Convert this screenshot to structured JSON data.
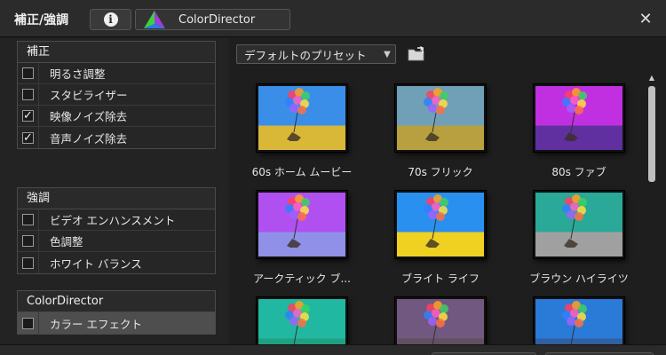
{
  "window": {
    "title": "補正/強調",
    "colordirector_button": "ColorDirector",
    "close_label": "✕",
    "info_glyph": "i"
  },
  "groups": [
    {
      "header": "補正",
      "items": [
        {
          "label": "明るさ調整",
          "checked": false
        },
        {
          "label": "スタビライザー",
          "checked": false
        },
        {
          "label": "映像ノイズ除去",
          "checked": true
        },
        {
          "label": "音声ノイズ除去",
          "checked": true
        }
      ]
    },
    {
      "header": "強調",
      "items": [
        {
          "label": "ビデオ エンハンスメント",
          "checked": false
        },
        {
          "label": "色調整",
          "checked": false
        },
        {
          "label": "ホワイト バランス",
          "checked": false
        }
      ]
    },
    {
      "header": "ColorDirector",
      "items": [
        {
          "label": "カラー エフェクト",
          "checked": false,
          "selected": true
        }
      ]
    }
  ],
  "preset": {
    "selected": "デフォルトのプリセット",
    "arrow": "▼"
  },
  "presets": [
    {
      "label": "60s ホーム ムービー",
      "sky": "#3a8ee8",
      "ground": "#d9b838",
      "tint": "none"
    },
    {
      "label": "70s フリック",
      "sky": "#6fa0b8",
      "ground": "#b8a040",
      "tint": "sepia"
    },
    {
      "label": "80s ファブ",
      "sky": "#c030e0",
      "ground": "#6030a0",
      "tint": "purple"
    },
    {
      "label": "アークティック ブ...",
      "sky": "#b050f0",
      "ground": "#9090e8",
      "tint": "arctic"
    },
    {
      "label": "ブライト ライフ",
      "sky": "#2a90f0",
      "ground": "#f0d020",
      "tint": "bright"
    },
    {
      "label": "ブラウン ハイライツ",
      "sky": "#2aa898",
      "ground": "#a0a0a0",
      "tint": "teal"
    },
    {
      "label": "",
      "sky": "#20b8a0",
      "ground": "#20a080",
      "tint": "teal2"
    },
    {
      "label": "",
      "sky": "#705880",
      "ground": "#605060",
      "tint": "muted"
    },
    {
      "label": "",
      "sky": "#2a7ad8",
      "ground": "#3060a0",
      "tint": "blue"
    }
  ],
  "scrollbar": {
    "up_arrow": "▲"
  }
}
